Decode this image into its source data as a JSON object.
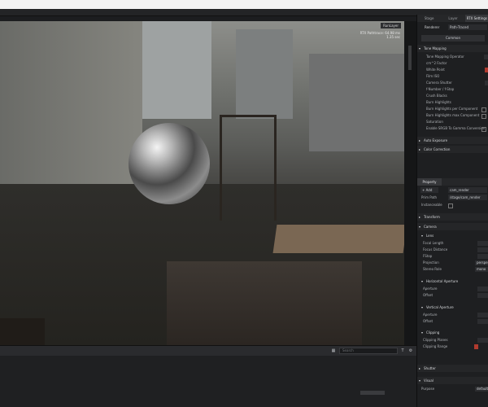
{
  "viewport": {
    "badge": "RunLayer",
    "fps_text": "RTX Pathtrace: 64.98 ms",
    "time_text": "1.35 sec"
  },
  "console": {
    "search_placeholder": "Search"
  },
  "panel": {
    "tabs": [
      "Stage",
      "Layer",
      "RTX Settings"
    ],
    "renderer_label": "Renderer",
    "renderer_value": "Path-Traced",
    "common_button": "Common",
    "tone_mapping": {
      "title": "Tone Mapping",
      "rows": [
        "Tone Mapping Operator",
        "cm^2 Factor",
        "White Point",
        "Film ISO",
        "Camera Shutter",
        "f-Number / f-Stop",
        "Crush Blacks",
        "Burn Highlights",
        "Burn Highlights per Component",
        "Burn Highlights max Component",
        "Saturation",
        "Enable SRGB To Gamma Conversion"
      ]
    },
    "auto_exposure": "Auto Exposure",
    "color_correction": "Color Correction",
    "property_tab": "Property",
    "add_button": "+ Add",
    "add_value": "cam_render",
    "prim_path_label": "Prim Path",
    "prim_path_value": "/stage/cam_render",
    "instanceable_label": "Instanceable",
    "transform": "Transform",
    "camera": "Camera",
    "lens": {
      "title": "Lens",
      "rows": [
        "Focal Length",
        "Focus Distance",
        "FStop",
        "Projection",
        "Stereo Role"
      ],
      "projection_value": "perspective",
      "stereo_value": "mono"
    },
    "horizontal_aperture": {
      "title": "Horizontal Aperture",
      "rows": [
        "Aperture",
        "Offset"
      ]
    },
    "vertical_aperture": {
      "title": "Vertical Aperture",
      "rows": [
        "Aperture",
        "Offset"
      ]
    },
    "clipping": {
      "title": "Clipping",
      "rows": [
        "Clipping Planes",
        "Clipping Range"
      ]
    },
    "shutter": "Shutter",
    "visual": {
      "title": "Visual",
      "purpose_label": "Purpose",
      "purpose_value": "default"
    }
  }
}
